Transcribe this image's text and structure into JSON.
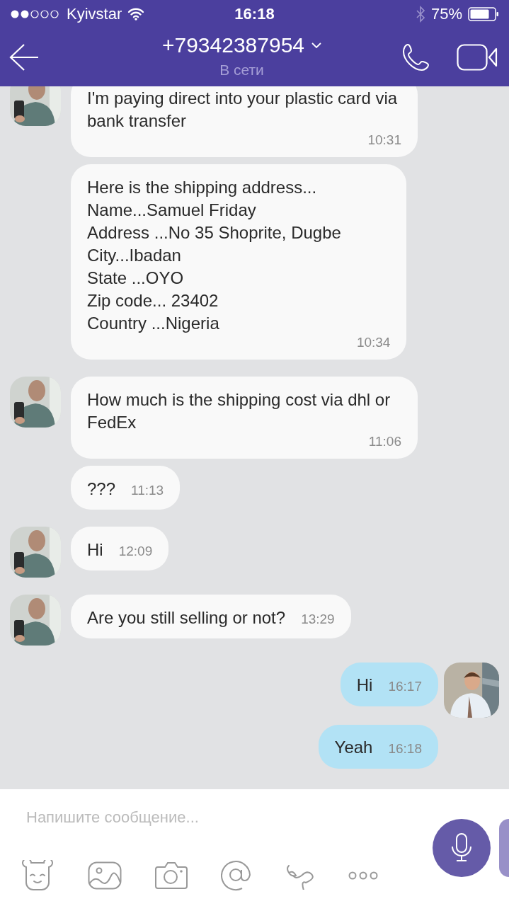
{
  "status_bar": {
    "carrier": "Kyivstar",
    "time": "16:18",
    "battery": "75%"
  },
  "header": {
    "title": "+79342387954",
    "subtitle": "В сети"
  },
  "messages": [
    {
      "kind": "incoming",
      "avatar": true,
      "text": "I'm paying direct into your plastic card via bank transfer",
      "time": "10:31"
    },
    {
      "kind": "incoming",
      "avatar": false,
      "text": "Here is the shipping address...\nName...Samuel Friday\nAddress ...No 35 Shoprite, Dugbe\nCity...Ibadan\nState ...OYO\nZip code... 23402\nCountry ...Nigeria",
      "time": "10:34"
    },
    {
      "kind": "incoming",
      "avatar": true,
      "text": "How much is the shipping cost via dhl or FedEx",
      "time": "11:06"
    },
    {
      "kind": "incoming",
      "avatar": false,
      "text": "???",
      "time": "11:13"
    },
    {
      "kind": "incoming",
      "avatar": true,
      "text": "Hi",
      "time": "12:09"
    },
    {
      "kind": "incoming",
      "avatar": true,
      "text": "Are you still selling or not?",
      "time": "13:29"
    },
    {
      "kind": "outgoing",
      "avatar": true,
      "text": "Hi",
      "time": "16:17"
    },
    {
      "kind": "outgoing",
      "avatar": false,
      "text": "Yeah",
      "time": "16:18"
    }
  ],
  "composer": {
    "placeholder": "Напишите сообщение..."
  }
}
